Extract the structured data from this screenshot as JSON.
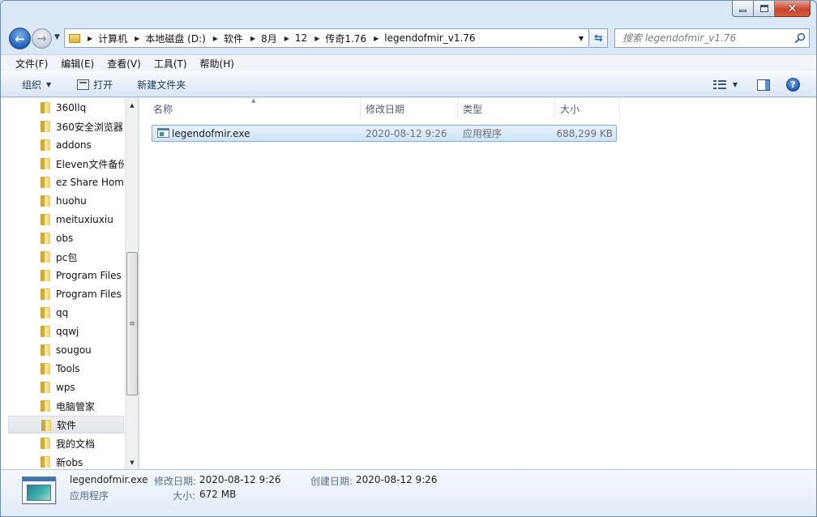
{
  "navigation": {
    "back_symbol": "←",
    "forward_symbol": "→",
    "recent_symbol": "▼"
  },
  "address": {
    "crumbs": [
      "计算机",
      "本地磁盘 (D:)",
      "软件",
      "8月",
      "12",
      "传奇1.76",
      "legendofmir_v1.76"
    ],
    "separator": "▶",
    "dropdown_symbol": "▼",
    "refresh_symbol": "⇆"
  },
  "search": {
    "placeholder": "搜索 legendofmir_v1.76"
  },
  "menu": [
    "文件(F)",
    "编辑(E)",
    "查看(V)",
    "工具(T)",
    "帮助(H)"
  ],
  "commands": {
    "organize": "组织",
    "organize_caret": "▼",
    "open": "打开",
    "new_folder": "新建文件夹",
    "view_caret": "▼",
    "help": "?"
  },
  "tree": {
    "items": [
      "360llq",
      "360安全浏览器",
      "addons",
      "Eleven文件备份",
      "ez Share Home",
      "huohu",
      "meituxiuxiu",
      "obs",
      "pc包",
      "Program Files",
      "Program Files",
      "qq",
      "qqwj",
      "sougou",
      "Tools",
      "wps",
      "电脑管家",
      "软件",
      "我的文档",
      "新obs"
    ],
    "selected_index": 17,
    "scroll_up": "▲",
    "scroll_down": "▼",
    "scroll_grip": "≡"
  },
  "columns": {
    "name": "名称",
    "modified": "修改日期",
    "type": "类型",
    "size": "大小",
    "sort_arrow": "▲"
  },
  "files": [
    {
      "name": "legendofmir.exe",
      "modified": "2020-08-12 9:26",
      "type": "应用程序",
      "size": "688,299 KB"
    }
  ],
  "details": {
    "filename": "legendofmir.exe",
    "type": "应用程序",
    "modified_label": "修改日期:",
    "modified_value": "2020-08-12 9:26",
    "size_label": "大小:",
    "size_value": "672 MB",
    "created_label": "创建日期:",
    "created_value": "2020-08-12 9:26"
  },
  "colors": {
    "accent": "#1f5fb7",
    "selection_bg": "#cfe4fa",
    "selection_border": "#84acdd",
    "close_button": "#c8462c"
  },
  "icons": {
    "back": "back-arrow-icon",
    "forward": "forward-arrow-icon",
    "folder": "folder-icon",
    "exe": "exe-file-icon",
    "search": "magnifier-icon",
    "help": "help-icon"
  }
}
